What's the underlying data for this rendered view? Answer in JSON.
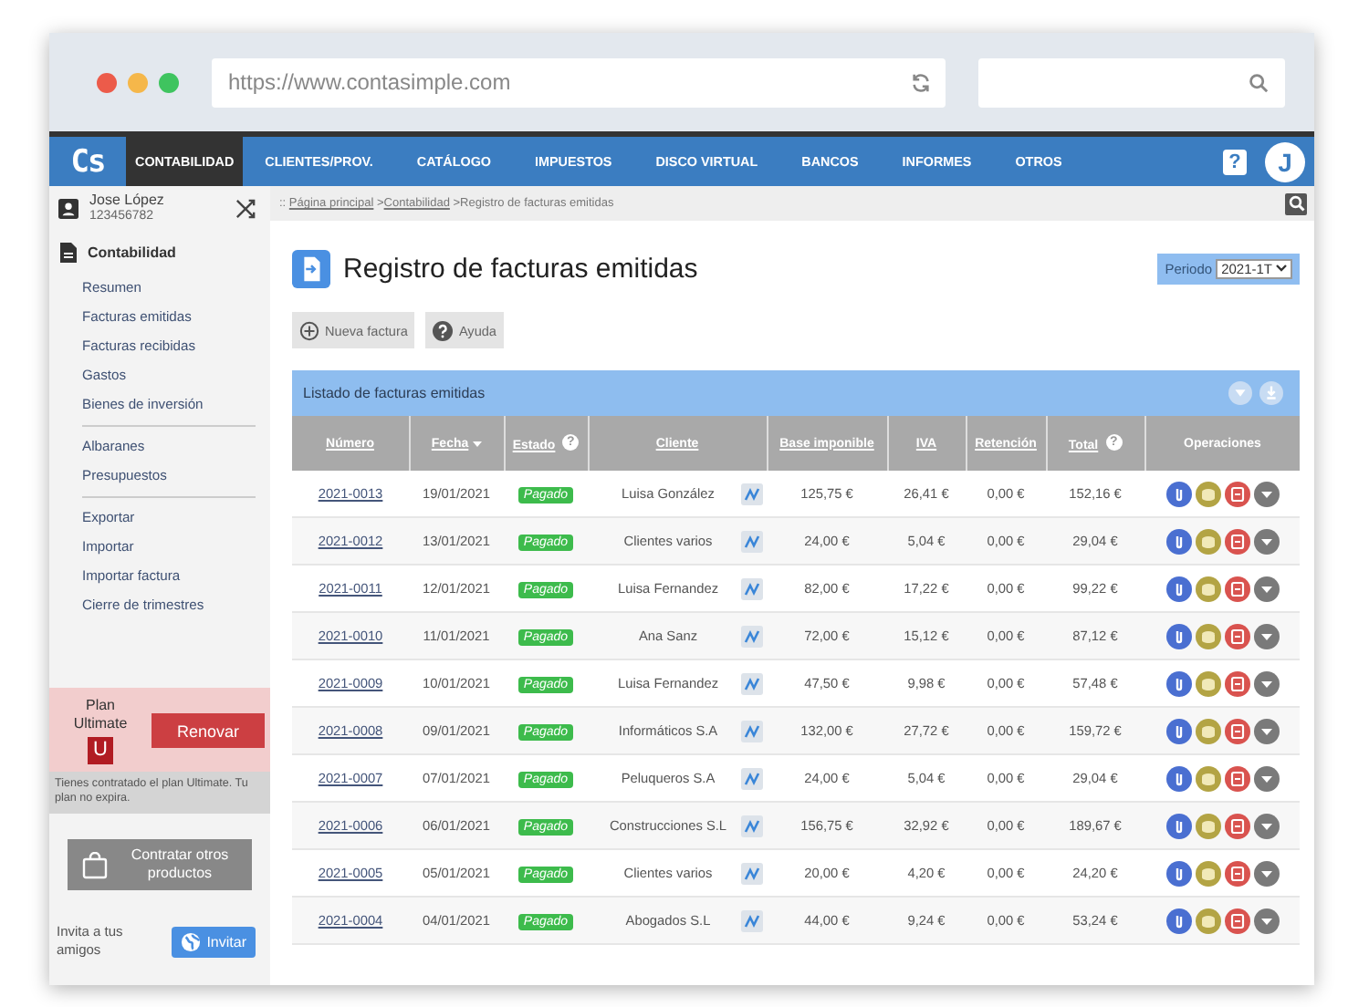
{
  "browser": {
    "url": "https://www.contasimple.com"
  },
  "navbar": {
    "logo": "Cs",
    "items": [
      {
        "label": "CONTABILIDAD",
        "selected": true
      },
      {
        "label": "CLIENTES/PROV.",
        "selected": false
      },
      {
        "label": "CATÁLOGO",
        "selected": false
      },
      {
        "label": "IMPUESTOS",
        "selected": false
      },
      {
        "label": "DISCO VIRTUAL",
        "selected": false
      },
      {
        "label": "BANCOS",
        "selected": false
      },
      {
        "label": "INFORMES",
        "selected": false
      },
      {
        "label": "OTROS",
        "selected": false
      }
    ],
    "help": "?",
    "avatar": "J"
  },
  "user": {
    "name": "Jose López",
    "id": "123456782"
  },
  "sidebar": {
    "section": "Contabilidad",
    "groups": [
      [
        "Resumen",
        "Facturas emitidas",
        "Facturas recibidas",
        "Gastos",
        "Bienes de inversión"
      ],
      [
        "Albaranes",
        "Presupuestos"
      ],
      [
        "Exportar",
        "Importar",
        "Importar factura",
        "Cierre de trimestres"
      ]
    ]
  },
  "plan": {
    "label": "Plan Ultimate",
    "badge": "U",
    "button": "Renovar",
    "note": "Tienes contratado el plan Ultimate. Tu plan no expira."
  },
  "shop_button": "Contratar otros productos",
  "invite": {
    "text": "Invita a tus amigos",
    "button": "Invitar"
  },
  "breadcrumb": {
    "prefix": "::",
    "separator": ">",
    "links": [
      "Página principal",
      "Contabilidad"
    ],
    "current": "Registro de facturas emitidas"
  },
  "page_title": "Registro de facturas emitidas",
  "period": {
    "label": "Periodo",
    "value": "2021-1T"
  },
  "actions": [
    "Nueva factura",
    "Ayuda"
  ],
  "panel_title": "Listado de facturas emitidas",
  "table": {
    "columns": [
      {
        "label": "Número",
        "sortable": true,
        "sorted": false
      },
      {
        "label": "Fecha",
        "sortable": true,
        "sorted": true
      },
      {
        "label": "Estado",
        "sortable": true,
        "sorted": false,
        "help": "?"
      },
      {
        "label": "Cliente",
        "sortable": true,
        "sorted": false
      },
      {
        "label": "Base imponible",
        "sortable": true,
        "sorted": false
      },
      {
        "label": "IVA",
        "sortable": true,
        "sorted": false
      },
      {
        "label": "Retención",
        "sortable": true,
        "sorted": false
      },
      {
        "label": "Total",
        "sortable": true,
        "sorted": false,
        "help": "?"
      },
      {
        "label": "Operaciones",
        "sortable": false,
        "sorted": false
      }
    ],
    "rows": [
      {
        "number": "2021-0013",
        "date": "19/01/2021",
        "status": "Pagado",
        "client": "Luisa González",
        "base": "125,75 €",
        "iva": "26,41 €",
        "retention": "0,00 €",
        "total": "152,16 €"
      },
      {
        "number": "2021-0012",
        "date": "13/01/2021",
        "status": "Pagado",
        "client": "Clientes varios",
        "base": "24,00 €",
        "iva": "5,04 €",
        "retention": "0,00 €",
        "total": "29,04 €"
      },
      {
        "number": "2021-0011",
        "date": "12/01/2021",
        "status": "Pagado",
        "client": "Luisa Fernandez",
        "base": "82,00 €",
        "iva": "17,22 €",
        "retention": "0,00 €",
        "total": "99,22 €"
      },
      {
        "number": "2021-0010",
        "date": "11/01/2021",
        "status": "Pagado",
        "client": "Ana Sanz",
        "base": "72,00 €",
        "iva": "15,12 €",
        "retention": "0,00 €",
        "total": "87,12 €"
      },
      {
        "number": "2021-0009",
        "date": "10/01/2021",
        "status": "Pagado",
        "client": "Luisa Fernandez",
        "base": "47,50 €",
        "iva": "9,98 €",
        "retention": "0,00 €",
        "total": "57,48 €"
      },
      {
        "number": "2021-0008",
        "date": "09/01/2021",
        "status": "Pagado",
        "client": "Informáticos S.A",
        "base": "132,00 €",
        "iva": "27,72 €",
        "retention": "0,00 €",
        "total": "159,72 €"
      },
      {
        "number": "2021-0007",
        "date": "07/01/2021",
        "status": "Pagado",
        "client": "Peluqueros S.A",
        "base": "24,00 €",
        "iva": "5,04 €",
        "retention": "0,00 €",
        "total": "29,04 €"
      },
      {
        "number": "2021-0006",
        "date": "06/01/2021",
        "status": "Pagado",
        "client": "Construcciones S.L",
        "base": "156,75 €",
        "iva": "32,92 €",
        "retention": "0,00 €",
        "total": "189,67 €"
      },
      {
        "number": "2021-0005",
        "date": "05/01/2021",
        "status": "Pagado",
        "client": "Clientes varios",
        "base": "20,00 €",
        "iva": "4,20 €",
        "retention": "0,00 €",
        "total": "24,20 €"
      },
      {
        "number": "2021-0004",
        "date": "04/01/2021",
        "status": "Pagado",
        "client": "Abogados S.L",
        "base": "44,00 €",
        "iva": "9,24 €",
        "retention": "0,00 €",
        "total": "53,24 €"
      }
    ]
  }
}
